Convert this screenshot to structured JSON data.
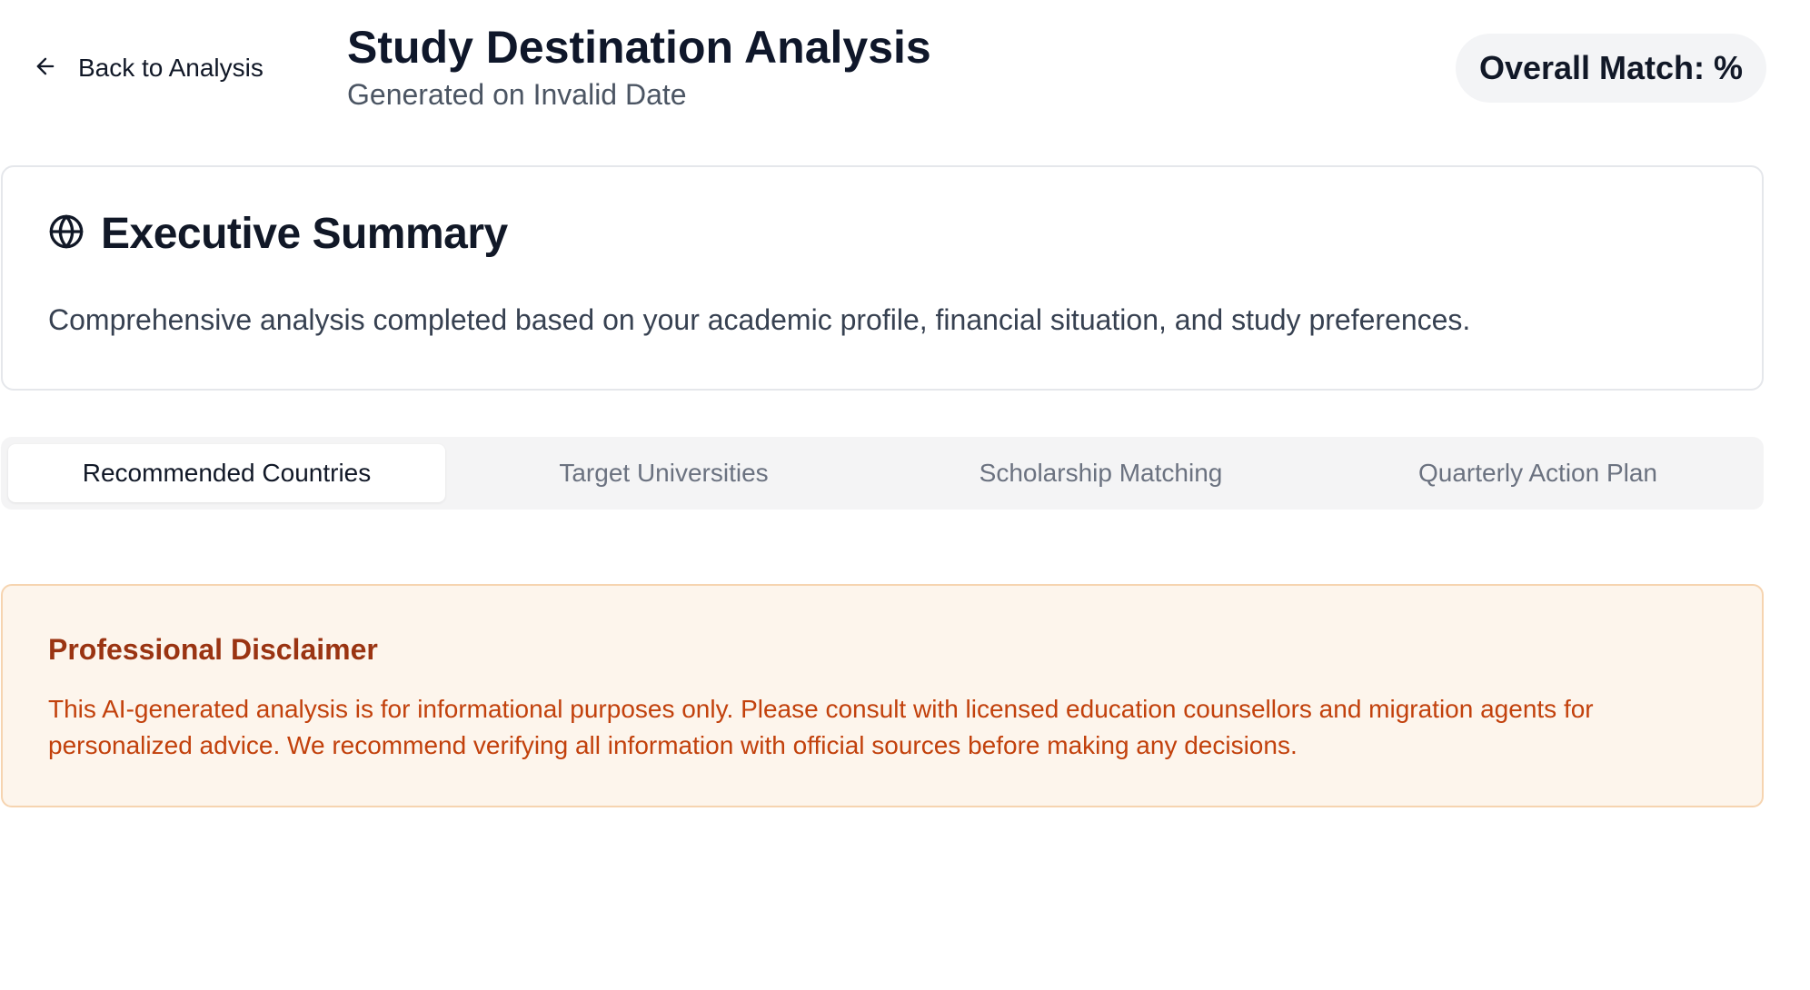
{
  "header": {
    "back_label": "Back to Analysis",
    "title": "Study Destination Analysis",
    "subtitle": "Generated on Invalid Date",
    "match_badge": "Overall Match: %"
  },
  "summary": {
    "icon": "globe-icon",
    "title": "Executive Summary",
    "text": "Comprehensive analysis completed based on your academic profile, financial situation, and study preferences."
  },
  "tabs": [
    {
      "label": "Recommended Countries",
      "active": true
    },
    {
      "label": "Target Universities",
      "active": false
    },
    {
      "label": "Scholarship Matching",
      "active": false
    },
    {
      "label": "Quarterly Action Plan",
      "active": false
    }
  ],
  "disclaimer": {
    "title": "Professional Disclaimer",
    "text": "This AI-generated analysis is for informational purposes only. Please consult with licensed education counsellors and migration agents for personalized advice. We recommend verifying all information with official sources before making any decisions."
  },
  "colors": {
    "disclaimer_bg": "#fdf5ec",
    "disclaimer_border": "#f6d4b0",
    "disclaimer_title": "#9a3412",
    "disclaimer_text": "#c2410c",
    "tabs_bg": "#f4f4f5",
    "badge_bg": "#f3f4f6"
  }
}
